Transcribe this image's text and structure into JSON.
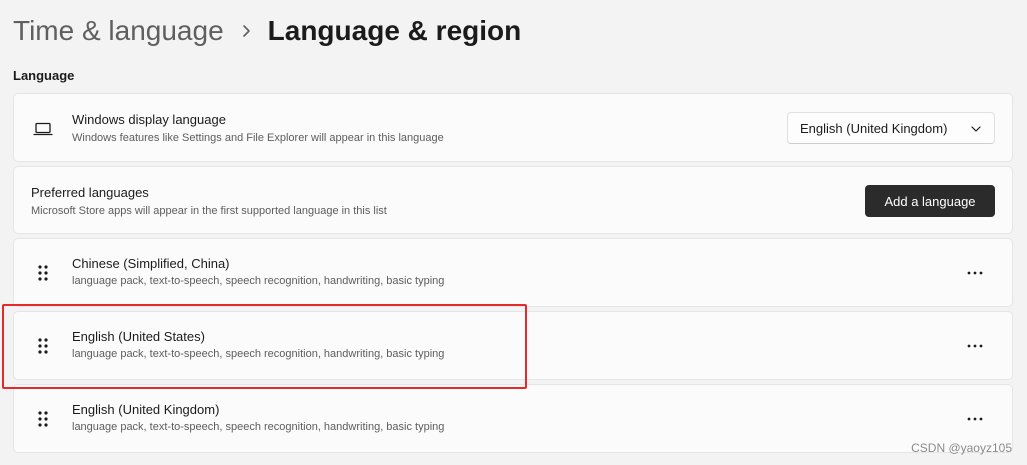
{
  "breadcrumb": {
    "parent": "Time & language",
    "current": "Language & region"
  },
  "language_section": {
    "heading": "Language",
    "display_language": {
      "title": "Windows display language",
      "subtitle": "Windows features like Settings and File Explorer will appear in this language",
      "selected": "English (United Kingdom)",
      "icon": "laptop-icon"
    },
    "preferred_languages": {
      "title": "Preferred languages",
      "subtitle": "Microsoft Store apps will appear in the first supported language in this list",
      "add_button_label": "Add a language"
    },
    "languages": [
      {
        "name": "Chinese (Simplified, China)",
        "features": "language pack, text-to-speech, speech recognition, handwriting, basic typing"
      },
      {
        "name": "English (United States)",
        "features": "language pack, text-to-speech, speech recognition, handwriting, basic typing",
        "highlighted": true
      },
      {
        "name": "English (United Kingdom)",
        "features": "language pack, text-to-speech, speech recognition, handwriting, basic typing"
      }
    ]
  },
  "watermark": "CSDN @yaoyz105",
  "colors": {
    "background": "#f3f3f3",
    "card": "#fbfbfb",
    "primary_button": "#2b2b2b",
    "highlight": "#e32b2b"
  }
}
